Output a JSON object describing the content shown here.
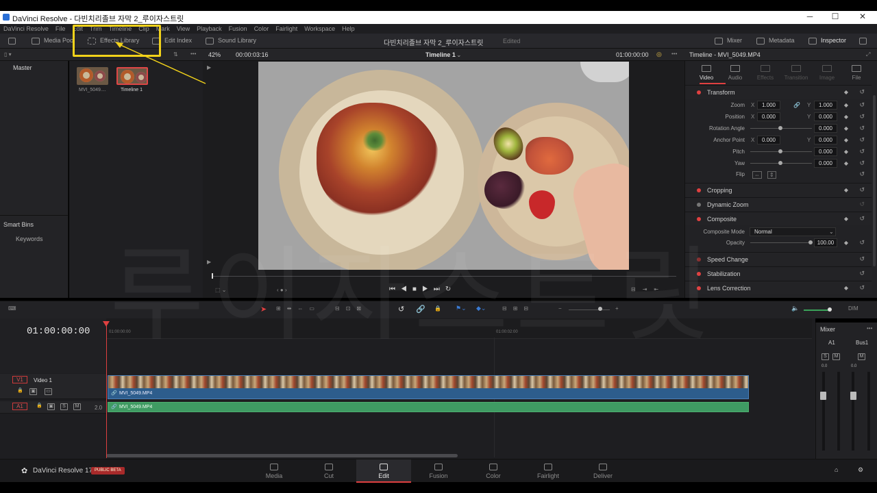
{
  "window": {
    "title": "DaVinci Resolve - 다빈치리졸브 자막 2_루이자스트릿",
    "minimize": "─",
    "maximize": "☐",
    "close": "✕"
  },
  "menu": [
    "DaVinci Resolve",
    "File",
    "Edit",
    "Trim",
    "Timeline",
    "Clip",
    "Mark",
    "View",
    "Playback",
    "Fusion",
    "Color",
    "Fairlight",
    "Workspace",
    "Help"
  ],
  "toolbar": {
    "media_pool": "Media Pool",
    "effects_library": "Effects Library",
    "edit_index": "Edit Index",
    "sound_library": "Sound Library",
    "project_name": "다빈치리졸브 자막 2_루이자스트릿",
    "edited": "Edited",
    "mixer": "Mixer",
    "metadata": "Metadata",
    "inspector": "Inspector"
  },
  "viewer_bar": {
    "zoom": "42%",
    "timecode": "00:00:03:16",
    "timeline_name": "Timeline 1",
    "record_tc": "01:00:00:00"
  },
  "bins": {
    "master": "Master",
    "smart_bins": "Smart Bins",
    "keywords": "Keywords"
  },
  "media_pool_items": [
    {
      "label": "MVI_5049...."
    },
    {
      "label": "Timeline 1"
    }
  ],
  "inspector": {
    "header": "Timeline - MVI_5049.MP4",
    "tabs": [
      "Video",
      "Audio",
      "Effects",
      "Transition",
      "Image",
      "File"
    ],
    "transform_label": "Transform",
    "params": {
      "zoom": {
        "label": "Zoom",
        "x": "1.000",
        "y": "1.000"
      },
      "position": {
        "label": "Position",
        "x": "0.000",
        "y": "0.000"
      },
      "rotation": {
        "label": "Rotation Angle",
        "value": "0.000"
      },
      "anchor": {
        "label": "Anchor Point",
        "x": "0.000",
        "y": "0.000"
      },
      "pitch": {
        "label": "Pitch",
        "value": "0.000"
      },
      "yaw": {
        "label": "Yaw",
        "value": "0.000"
      },
      "flip": {
        "label": "Flip"
      }
    },
    "sections": {
      "cropping": "Cropping",
      "dynamic_zoom": "Dynamic Zoom",
      "composite": "Composite",
      "composite_mode_label": "Composite Mode",
      "composite_mode_value": "Normal",
      "opacity_label": "Opacity",
      "opacity_value": "100.00",
      "speed_change": "Speed Change",
      "stabilization": "Stabilization",
      "lens_correction": "Lens Correction"
    }
  },
  "timeline": {
    "timecode": "01:00:00:00",
    "ruler": [
      "01:00:00:00",
      "01:00:02:00"
    ],
    "video_track": {
      "tag": "V1",
      "name": "Video 1",
      "clip": "MVI_5049.MP4"
    },
    "audio_track": {
      "tag": "A1",
      "level": "2.0",
      "clip": "MVI_5049.MP4"
    }
  },
  "mixer": {
    "title": "Mixer",
    "ch1": "A1",
    "ch2": "Bus1",
    "val1": "0.0",
    "val2": "0.0"
  },
  "pages": [
    "Media",
    "Cut",
    "Edit",
    "Fusion",
    "Color",
    "Fairlight",
    "Deliver"
  ],
  "active_page": "Edit",
  "brand": {
    "name": "DaVinci Resolve 17",
    "badge": "PUBLIC BETA"
  },
  "watermark": "루이자스트릿",
  "colors": {
    "accent": "#e04040",
    "highlight": "#f2d21a",
    "video_clip": "#2d5d8c",
    "audio_clip": "#3f9b63"
  }
}
